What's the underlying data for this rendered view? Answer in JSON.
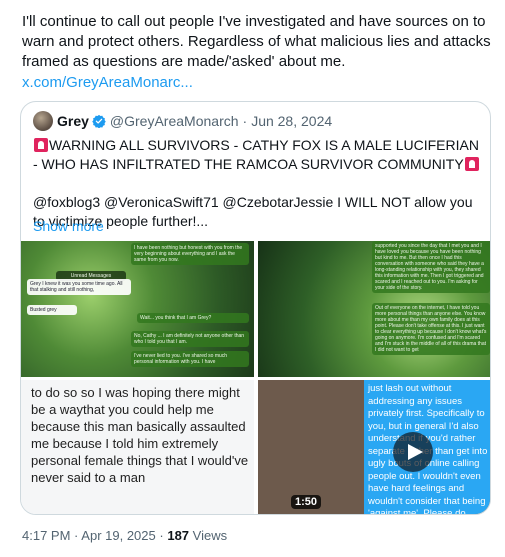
{
  "tweet": {
    "text": "I'll continue to call out people I've investigated and have sources on to warn and protect others. Regardless of what malicious lies and attacks framed as questions are made/'asked' about me.",
    "link": "x.com/GreyAreaMonarc..."
  },
  "quote": {
    "name": "Grey",
    "handle": "@GreyAreaMonarch",
    "separator": "·",
    "date": "Jun 28, 2024",
    "headline": "WARNING ALL SURVIVORS - CATHY FOX IS A MALE LUCIFERIAN - WHO HAS INFILTRATED THE RAMCOA SURVIVOR COMMUNITY",
    "mentions": "@foxblog3 @VeronicaSwift71 @CzebotarJessie I WILL NOT allow you to victimize people further!...",
    "show_more": "Show more"
  },
  "media": {
    "img1": {
      "b1": "I have been nothing but honest with you from the very beginning about everything and I ask the same from you now.",
      "b2": "Unread Messages",
      "b3": "Grey I knew it was you some time ago. All that stalking and still nothing,",
      "b4": "Busted grey",
      "b5": "Wait... you think that I am Grey?",
      "b6": "No, Cathy ... I am definitely not anyone other than who I told you that I am.",
      "b7": "I've never lied to you. I've shared so much personal information with you. I have"
    },
    "img2": {
      "b1": "supported you since the day that I met you and I have loved you because you have been nothing but kind to me. But then once I had this conversation with someone who said they have a long-standing relationship with you, they shared this information with me. Then I got triggered and scared and I reached out to you. I'm asking for your side of the story.",
      "b2": "Out of everyone on the internet, I have told you more personal things than anyone else. You know more about me than my own family does at this point. Please don't take offense at this. I just want to clear everything up because I don't know what's going on anymore. I'm confused and I'm scared and I'm stuck in the middle of all of this drama that I did not want to get"
    },
    "img3_text": "to do so so I was hoping there might be a waythat you could help me because this man basically assaulted me because I told him extremely personal female things that I would've never said to a man",
    "img4_text": "just lash out without addressing any issues privately first. Specifically to you, but in general I'd also understand if you'd rather separate rather than get into ugly bouts of online calling people out. I wouldn't even have hard feelings and wouldn't consider that being 'against me'. Please do know that the people I adamantly call out is",
    "duration": "1:50"
  },
  "meta": {
    "time": "4:17 PM",
    "separator": "·",
    "date": "Apr 19, 2025",
    "views_count": "187",
    "views_label": "Views"
  },
  "colors": {
    "link": "#1d9bf0",
    "verified": "#1d9bf0",
    "secondary_text": "#536471",
    "border": "#cfd9de",
    "siren": "#e0245e"
  }
}
